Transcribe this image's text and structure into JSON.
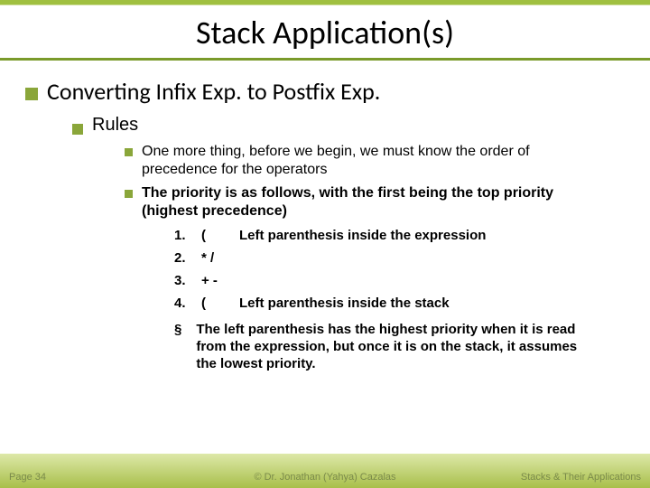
{
  "title": "Stack Application(s)",
  "heading": "Converting Infix Exp. to Postfix Exp.",
  "sub": "Rules",
  "point1": "One more thing, before we begin, we must know the order of precedence for the operators",
  "point2": "The priority is as follows, with the first being the top priority (highest precedence)",
  "prec": [
    {
      "n": "1.",
      "sym": "(",
      "desc": "Left parenthesis inside the expression"
    },
    {
      "n": "2.",
      "sym": "*    /",
      "desc": ""
    },
    {
      "n": "3.",
      "sym": "+    -",
      "desc": ""
    },
    {
      "n": "4.",
      "sym": "(",
      "desc": "Left parenthesis inside the stack"
    }
  ],
  "note_bullet": "§",
  "note": "The left parenthesis has the highest priority when it is read from the expression, but once it is on the stack, it assumes the lowest priority.",
  "footer": {
    "left": "Page 34",
    "mid": "© Dr. Jonathan (Yahya) Cazalas",
    "right": "Stacks & Their Applications"
  }
}
